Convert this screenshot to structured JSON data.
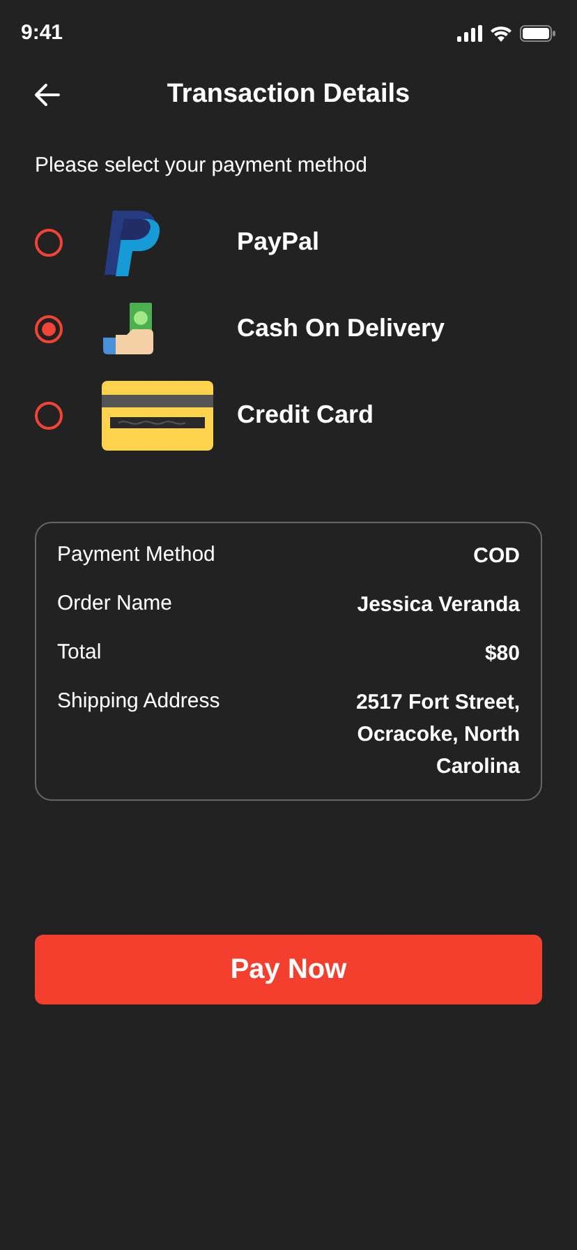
{
  "status_bar": {
    "time": "9:41"
  },
  "header": {
    "title": "Transaction Details"
  },
  "prompt": "Please select your payment method",
  "methods": [
    {
      "kind": "paypal",
      "label": "PayPal",
      "selected": false
    },
    {
      "kind": "cash",
      "label": "Cash On Delivery",
      "selected": true
    },
    {
      "kind": "card",
      "label": "Credit Card",
      "selected": false
    }
  ],
  "summary": [
    {
      "label": "Payment Method",
      "value": "COD"
    },
    {
      "label": "Order Name",
      "value": "Jessica Veranda"
    },
    {
      "label": "Total",
      "value": "$80"
    },
    {
      "label": "Shipping Address",
      "value": "2517 Fort Street, Ocracoke, North Carolina"
    }
  ],
  "pay_button": "Pay Now"
}
